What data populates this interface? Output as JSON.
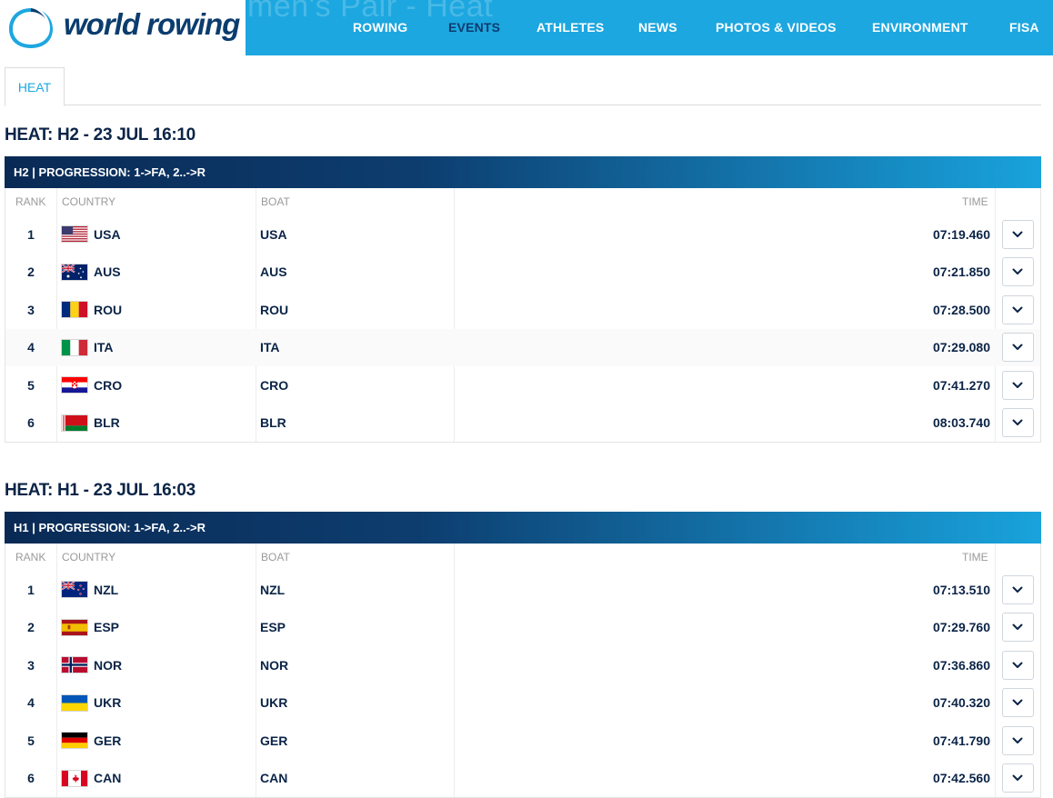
{
  "header": {
    "brand": "world rowing",
    "ghost_title": "men's Pair - Heat",
    "nav": [
      {
        "label": "ROWING",
        "active": false
      },
      {
        "label": "EVENTS",
        "active": true
      },
      {
        "label": "ATHLETES",
        "active": false
      },
      {
        "label": "NEWS",
        "active": false
      },
      {
        "label": "PHOTOS & VIDEOS",
        "active": false
      },
      {
        "label": "ENVIRONMENT",
        "active": false
      },
      {
        "label": "FISA",
        "active": false
      }
    ]
  },
  "tabs": [
    {
      "label": "HEAT",
      "active": true
    }
  ],
  "columns": {
    "rank": "RANK",
    "country": "COUNTRY",
    "boat": "BOAT",
    "time": "TIME"
  },
  "races": [
    {
      "title": "HEAT: H2 - 23 JUL 16:10",
      "progression": "H2 | PROGRESSION: 1->FA, 2..->R",
      "results": [
        {
          "rank": "1",
          "country": "USA",
          "boat": "USA",
          "time": "07:19.460",
          "flag": "usa-flag-icon"
        },
        {
          "rank": "2",
          "country": "AUS",
          "boat": "AUS",
          "time": "07:21.850",
          "flag": "aus-flag-icon"
        },
        {
          "rank": "3",
          "country": "ROU",
          "boat": "ROU",
          "time": "07:28.500",
          "flag": "rou-flag-icon"
        },
        {
          "rank": "4",
          "country": "ITA",
          "boat": "ITA",
          "time": "07:29.080",
          "flag": "ita-flag-icon"
        },
        {
          "rank": "5",
          "country": "CRO",
          "boat": "CRO",
          "time": "07:41.270",
          "flag": "cro-flag-icon"
        },
        {
          "rank": "6",
          "country": "BLR",
          "boat": "BLR",
          "time": "08:03.740",
          "flag": "blr-flag-icon"
        }
      ]
    },
    {
      "title": "HEAT: H1 - 23 JUL 16:03",
      "progression": "H1 | PROGRESSION: 1->FA, 2..->R",
      "results": [
        {
          "rank": "1",
          "country": "NZL",
          "boat": "NZL",
          "time": "07:13.510",
          "flag": "nzl-flag-icon"
        },
        {
          "rank": "2",
          "country": "ESP",
          "boat": "ESP",
          "time": "07:29.760",
          "flag": "esp-flag-icon"
        },
        {
          "rank": "3",
          "country": "NOR",
          "boat": "NOR",
          "time": "07:36.860",
          "flag": "nor-flag-icon"
        },
        {
          "rank": "4",
          "country": "UKR",
          "boat": "UKR",
          "time": "07:40.320",
          "flag": "ukr-flag-icon"
        },
        {
          "rank": "5",
          "country": "GER",
          "boat": "GER",
          "time": "07:41.790",
          "flag": "ger-flag-icon"
        },
        {
          "rank": "6",
          "country": "CAN",
          "boat": "CAN",
          "time": "07:42.560",
          "flag": "can-flag-icon"
        }
      ]
    }
  ],
  "colors": {
    "brand_blue": "#1da7e0",
    "navy": "#0b2447",
    "nav_active": "#0b3c6e"
  }
}
